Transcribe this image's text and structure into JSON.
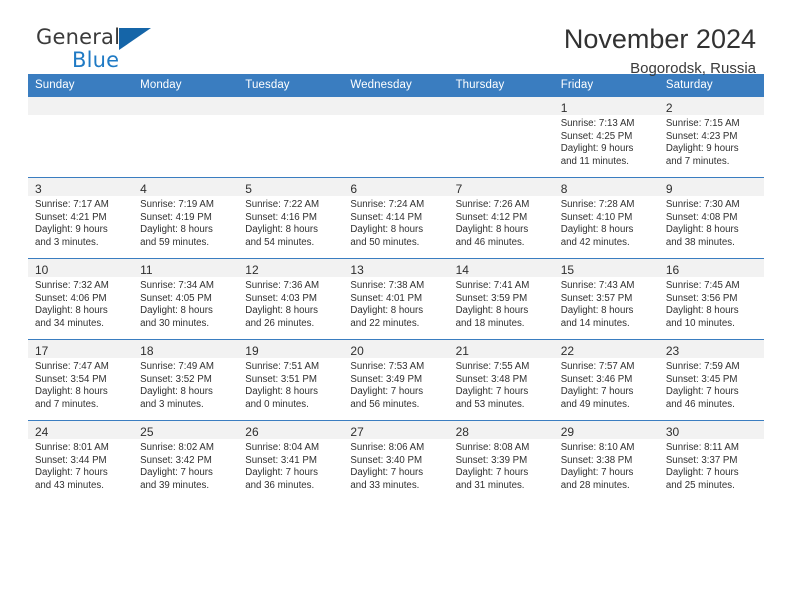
{
  "brand": {
    "name_part1": "General",
    "name_part2": "Blue",
    "accent_color": "#1f7ac4"
  },
  "header": {
    "title": "November 2024",
    "subtitle": "Bogorodsk, Russia"
  },
  "theme": {
    "header_bg": "#3a7dc0",
    "daynum_bg": "#f2f2f2",
    "text": "#303030"
  },
  "weekdays": [
    "Sunday",
    "Monday",
    "Tuesday",
    "Wednesday",
    "Thursday",
    "Friday",
    "Saturday"
  ],
  "weeks": [
    [
      {
        "day": "",
        "lines": []
      },
      {
        "day": "",
        "lines": []
      },
      {
        "day": "",
        "lines": []
      },
      {
        "day": "",
        "lines": []
      },
      {
        "day": "",
        "lines": []
      },
      {
        "day": "1",
        "lines": [
          "Sunrise: 7:13 AM",
          "Sunset: 4:25 PM",
          "Daylight: 9 hours",
          "and 11 minutes."
        ]
      },
      {
        "day": "2",
        "lines": [
          "Sunrise: 7:15 AM",
          "Sunset: 4:23 PM",
          "Daylight: 9 hours",
          "and 7 minutes."
        ]
      }
    ],
    [
      {
        "day": "3",
        "lines": [
          "Sunrise: 7:17 AM",
          "Sunset: 4:21 PM",
          "Daylight: 9 hours",
          "and 3 minutes."
        ]
      },
      {
        "day": "4",
        "lines": [
          "Sunrise: 7:19 AM",
          "Sunset: 4:19 PM",
          "Daylight: 8 hours",
          "and 59 minutes."
        ]
      },
      {
        "day": "5",
        "lines": [
          "Sunrise: 7:22 AM",
          "Sunset: 4:16 PM",
          "Daylight: 8 hours",
          "and 54 minutes."
        ]
      },
      {
        "day": "6",
        "lines": [
          "Sunrise: 7:24 AM",
          "Sunset: 4:14 PM",
          "Daylight: 8 hours",
          "and 50 minutes."
        ]
      },
      {
        "day": "7",
        "lines": [
          "Sunrise: 7:26 AM",
          "Sunset: 4:12 PM",
          "Daylight: 8 hours",
          "and 46 minutes."
        ]
      },
      {
        "day": "8",
        "lines": [
          "Sunrise: 7:28 AM",
          "Sunset: 4:10 PM",
          "Daylight: 8 hours",
          "and 42 minutes."
        ]
      },
      {
        "day": "9",
        "lines": [
          "Sunrise: 7:30 AM",
          "Sunset: 4:08 PM",
          "Daylight: 8 hours",
          "and 38 minutes."
        ]
      }
    ],
    [
      {
        "day": "10",
        "lines": [
          "Sunrise: 7:32 AM",
          "Sunset: 4:06 PM",
          "Daylight: 8 hours",
          "and 34 minutes."
        ]
      },
      {
        "day": "11",
        "lines": [
          "Sunrise: 7:34 AM",
          "Sunset: 4:05 PM",
          "Daylight: 8 hours",
          "and 30 minutes."
        ]
      },
      {
        "day": "12",
        "lines": [
          "Sunrise: 7:36 AM",
          "Sunset: 4:03 PM",
          "Daylight: 8 hours",
          "and 26 minutes."
        ]
      },
      {
        "day": "13",
        "lines": [
          "Sunrise: 7:38 AM",
          "Sunset: 4:01 PM",
          "Daylight: 8 hours",
          "and 22 minutes."
        ]
      },
      {
        "day": "14",
        "lines": [
          "Sunrise: 7:41 AM",
          "Sunset: 3:59 PM",
          "Daylight: 8 hours",
          "and 18 minutes."
        ]
      },
      {
        "day": "15",
        "lines": [
          "Sunrise: 7:43 AM",
          "Sunset: 3:57 PM",
          "Daylight: 8 hours",
          "and 14 minutes."
        ]
      },
      {
        "day": "16",
        "lines": [
          "Sunrise: 7:45 AM",
          "Sunset: 3:56 PM",
          "Daylight: 8 hours",
          "and 10 minutes."
        ]
      }
    ],
    [
      {
        "day": "17",
        "lines": [
          "Sunrise: 7:47 AM",
          "Sunset: 3:54 PM",
          "Daylight: 8 hours",
          "and 7 minutes."
        ]
      },
      {
        "day": "18",
        "lines": [
          "Sunrise: 7:49 AM",
          "Sunset: 3:52 PM",
          "Daylight: 8 hours",
          "and 3 minutes."
        ]
      },
      {
        "day": "19",
        "lines": [
          "Sunrise: 7:51 AM",
          "Sunset: 3:51 PM",
          "Daylight: 8 hours",
          "and 0 minutes."
        ]
      },
      {
        "day": "20",
        "lines": [
          "Sunrise: 7:53 AM",
          "Sunset: 3:49 PM",
          "Daylight: 7 hours",
          "and 56 minutes."
        ]
      },
      {
        "day": "21",
        "lines": [
          "Sunrise: 7:55 AM",
          "Sunset: 3:48 PM",
          "Daylight: 7 hours",
          "and 53 minutes."
        ]
      },
      {
        "day": "22",
        "lines": [
          "Sunrise: 7:57 AM",
          "Sunset: 3:46 PM",
          "Daylight: 7 hours",
          "and 49 minutes."
        ]
      },
      {
        "day": "23",
        "lines": [
          "Sunrise: 7:59 AM",
          "Sunset: 3:45 PM",
          "Daylight: 7 hours",
          "and 46 minutes."
        ]
      }
    ],
    [
      {
        "day": "24",
        "lines": [
          "Sunrise: 8:01 AM",
          "Sunset: 3:44 PM",
          "Daylight: 7 hours",
          "and 43 minutes."
        ]
      },
      {
        "day": "25",
        "lines": [
          "Sunrise: 8:02 AM",
          "Sunset: 3:42 PM",
          "Daylight: 7 hours",
          "and 39 minutes."
        ]
      },
      {
        "day": "26",
        "lines": [
          "Sunrise: 8:04 AM",
          "Sunset: 3:41 PM",
          "Daylight: 7 hours",
          "and 36 minutes."
        ]
      },
      {
        "day": "27",
        "lines": [
          "Sunrise: 8:06 AM",
          "Sunset: 3:40 PM",
          "Daylight: 7 hours",
          "and 33 minutes."
        ]
      },
      {
        "day": "28",
        "lines": [
          "Sunrise: 8:08 AM",
          "Sunset: 3:39 PM",
          "Daylight: 7 hours",
          "and 31 minutes."
        ]
      },
      {
        "day": "29",
        "lines": [
          "Sunrise: 8:10 AM",
          "Sunset: 3:38 PM",
          "Daylight: 7 hours",
          "and 28 minutes."
        ]
      },
      {
        "day": "30",
        "lines": [
          "Sunrise: 8:11 AM",
          "Sunset: 3:37 PM",
          "Daylight: 7 hours",
          "and 25 minutes."
        ]
      }
    ]
  ]
}
